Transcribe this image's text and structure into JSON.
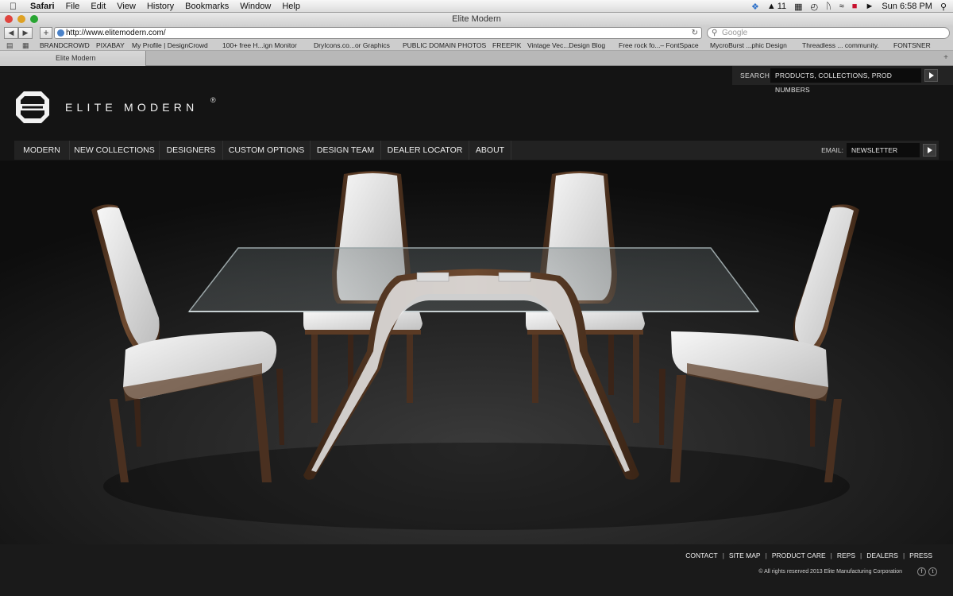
{
  "menubar": {
    "app": "Safari",
    "items": [
      "File",
      "Edit",
      "View",
      "History",
      "Bookmarks",
      "Window",
      "Help"
    ],
    "status_number": "11",
    "clock": "Sun 6:58 PM"
  },
  "window": {
    "title": "Elite Modern"
  },
  "toolbar": {
    "url": "http://www.elitemodern.com/",
    "search_placeholder": "Google"
  },
  "bookmarks": [
    "BRANDCROWD",
    "PIXABAY",
    "My Profile | DesignCrowd",
    "100+ free H...ign Monitor",
    "DryIcons.co...or Graphics",
    "PUBLIC DOMAIN PHOTOS",
    "FREEPIK",
    "Vintage Vec...Design Blog",
    "Free rock fo...– FontSpace",
    "MycroBurst ...phic Design",
    "Threadless ... community.",
    "FONTSNER"
  ],
  "tab": {
    "label": "Elite Modern"
  },
  "site": {
    "brand": "ELITE MODERN",
    "reg": "®",
    "search": {
      "label": "SEARCH",
      "placeholder": "PRODUCTS, COLLECTIONS, PROD NUMBERS"
    },
    "nav": [
      "MODERN",
      "NEW COLLECTIONS",
      "DESIGNERS",
      "CUSTOM OPTIONS",
      "DESIGN TEAM",
      "DEALER LOCATOR",
      "ABOUT"
    ],
    "email": {
      "label": "EMAIL:",
      "placeholder": "NEWSLETTER"
    },
    "footer": {
      "links": [
        "CONTACT",
        "SITE MAP",
        "PRODUCT CARE",
        "REPS",
        "DEALERS",
        "PRESS"
      ],
      "copyright": "© All rights reserved 2013 Elite Manufacturing Corporation"
    }
  },
  "colors": {
    "site_bg": "#141414",
    "nav_bg": "#222222",
    "chair_white": "#ececec",
    "wood": "#5a3a24"
  }
}
